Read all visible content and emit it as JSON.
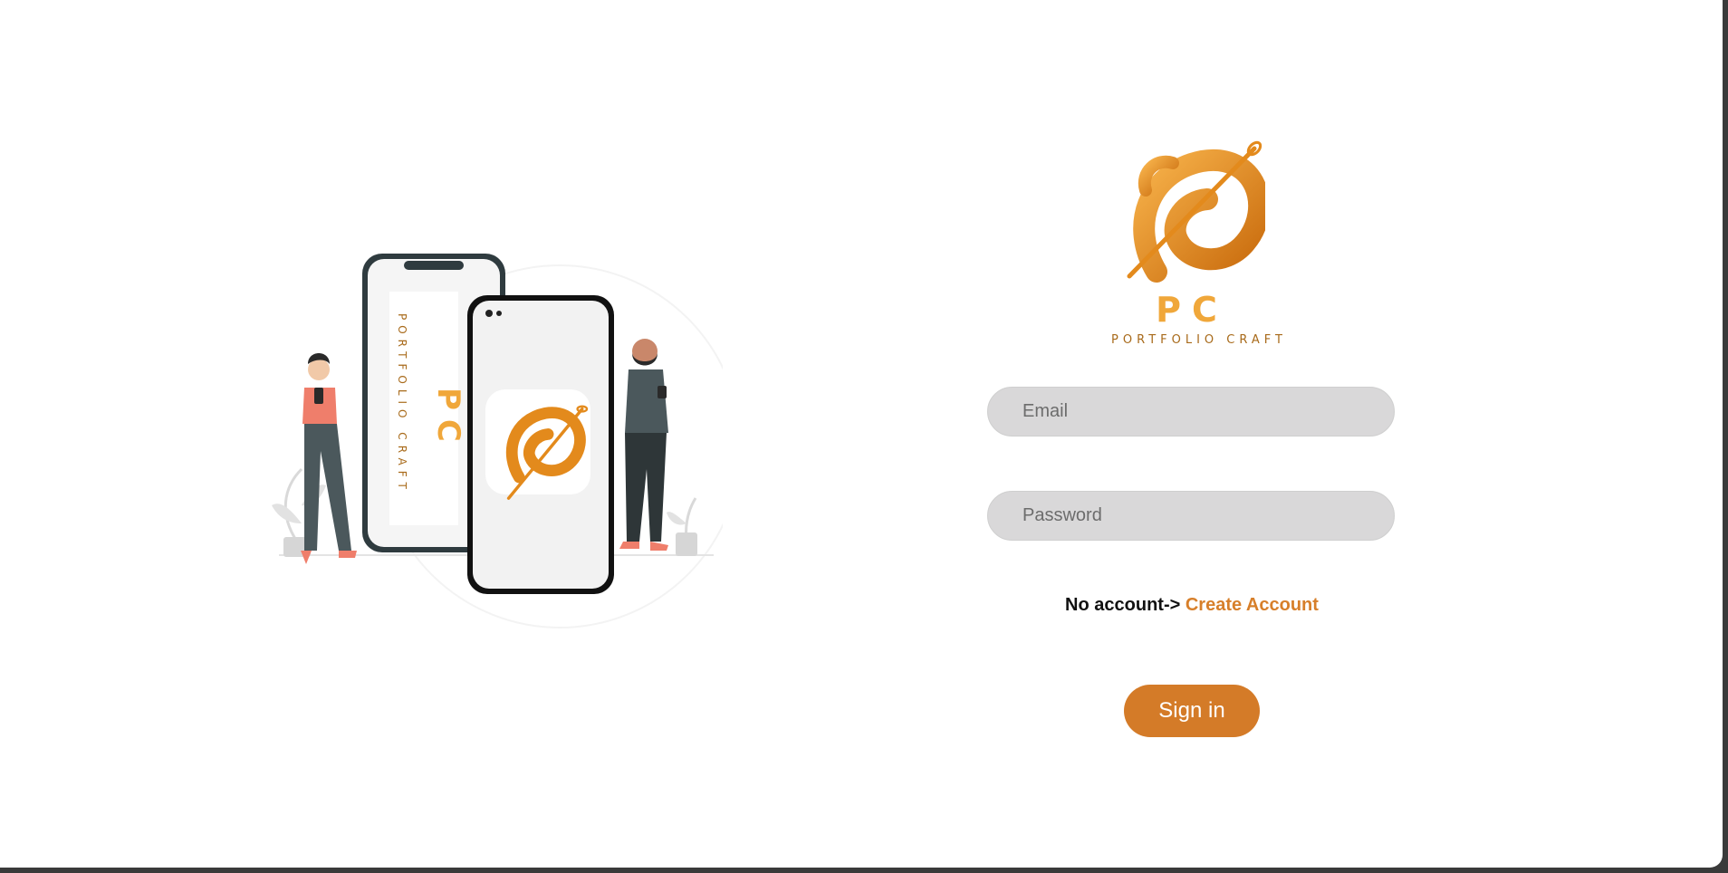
{
  "brand": {
    "initials": "PC",
    "name": "PORTFOLIO CRAFT",
    "accent": "#d47b28",
    "logo_gradient": [
      "#f7b24a",
      "#c86a0c"
    ]
  },
  "illustration": {
    "phone_left_initials": "PC",
    "phone_left_name": "PORTFOLIO CRAFT",
    "icon": "phones-with-people-illustration"
  },
  "login": {
    "email_placeholder": "Email",
    "password_placeholder": "Password",
    "no_account_text": "No account->",
    "create_account_link": "Create Account",
    "signin_label": "Sign in"
  }
}
